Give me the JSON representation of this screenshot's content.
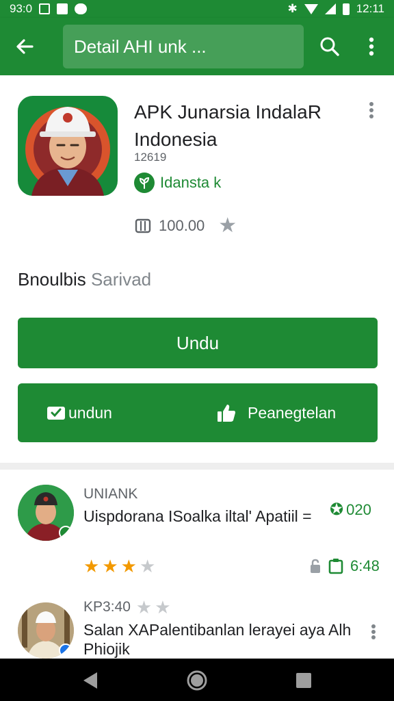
{
  "status_bar": {
    "time_left": "93:0",
    "time_right": "12:11"
  },
  "app_bar": {
    "search_text": "Detail AHI unk ...",
    "back_icon": "arrow-left-icon",
    "search_icon": "search-icon",
    "menu_icon": "more-vert-icon"
  },
  "app": {
    "title": "APK Junarsia IndalaR Indonesia",
    "version": "12619",
    "developer": "Idansta k",
    "rating_count": "100.00",
    "category_label": "Bnoulbis",
    "category_value": "Sarivad"
  },
  "buttons": {
    "primary": "Undu",
    "secondary_left": "undun",
    "secondary_right": "Peanegtelan"
  },
  "reviews": [
    {
      "reviewer": "UNIANK",
      "text": "Uispdorana ISoalka iltal' Apatiil =",
      "likes": "020",
      "stars_on": 3,
      "stars_total": 4,
      "meta": "6:48"
    },
    {
      "reviewer": "KP3:40",
      "text": "Salan XAPalentibanlan lerayei aya Alh Phiojik",
      "stars_on": 0,
      "stars_total": 2
    }
  ],
  "colors": {
    "primary": "#1e8a34",
    "star": "#f29900"
  }
}
